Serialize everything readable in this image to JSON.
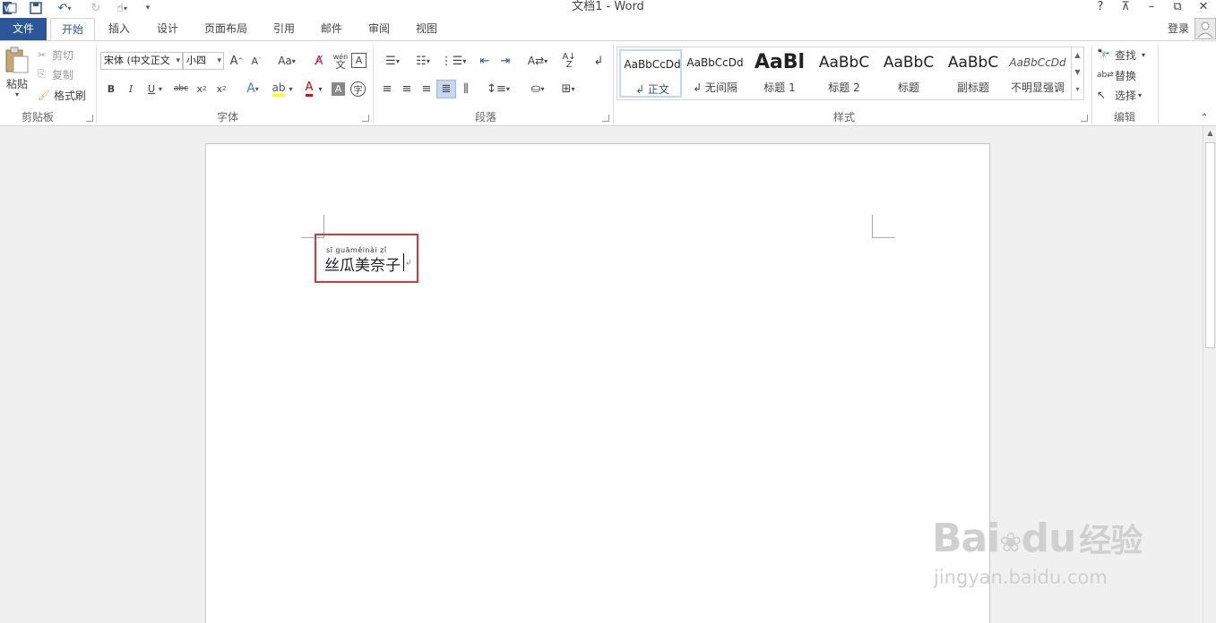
{
  "window": {
    "title": "文档1 - Word",
    "help": "?",
    "login": "登录"
  },
  "tabs": {
    "file": "文件",
    "home": "开始",
    "insert": "插入",
    "design": "设计",
    "layout": "页面布局",
    "references": "引用",
    "mailings": "邮件",
    "review": "审阅",
    "view": "视图"
  },
  "clipboard": {
    "paste": "粘贴",
    "cut": "剪切",
    "copy": "复制",
    "format_painter": "格式刷",
    "group": "剪贴板"
  },
  "font": {
    "name": "宋体 (中文正文",
    "size": "小四",
    "group": "字体",
    "pinyin_top": "wén",
    "pinyin_char": "文",
    "case": "Aa"
  },
  "paragraph": {
    "group": "段落"
  },
  "styles": {
    "group": "样式",
    "items": [
      {
        "preview": "AaBbCcDd",
        "name": "↲ 正文"
      },
      {
        "preview": "AaBbCcDd",
        "name": "↲ 无间隔"
      },
      {
        "preview": "AaBl",
        "name": "标题 1"
      },
      {
        "preview": "AaBbC",
        "name": "标题 2"
      },
      {
        "preview": "AaBbC",
        "name": "标题"
      },
      {
        "preview": "AaBbC",
        "name": "副标题"
      },
      {
        "preview": "AaBbCcDd",
        "name": "不明显强调"
      }
    ]
  },
  "editing": {
    "find": "查找",
    "replace": "替换",
    "select": "选择",
    "group": "编辑"
  },
  "document": {
    "pinyin": "sī guāměinài zǐ",
    "text": "丝瓜美奈子"
  },
  "watermark": {
    "brand": "Bai",
    "brand2": "du",
    "cn": "经验",
    "url": "jingyan.baidu.com"
  },
  "colors": {
    "accent": "#2b579a",
    "highlight_box": "#d9383a"
  }
}
